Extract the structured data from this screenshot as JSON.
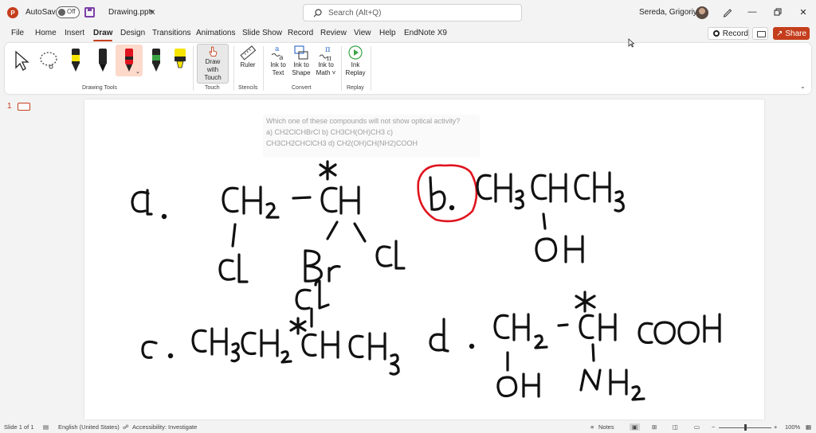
{
  "titlebar": {
    "logo_letter": "P",
    "autosave_label": "AutoSave",
    "autosave_state": "Off",
    "filename": "Drawing.pptx",
    "search_placeholder": "Search (Alt+Q)",
    "username": "Sereda, Grigoriy A"
  },
  "menu": {
    "tabs": [
      "File",
      "Home",
      "Insert",
      "Draw",
      "Design",
      "Transitions",
      "Animations",
      "Slide Show",
      "Record",
      "Review",
      "View",
      "Help",
      "EndNote X9"
    ],
    "active_tab": "Draw",
    "record_label": "Record",
    "share_label": "Share"
  },
  "ribbon": {
    "groups": {
      "drawing_tools": "Drawing Tools",
      "touch": "Touch",
      "stencils": "Stencils",
      "convert": "Convert",
      "replay": "Replay"
    },
    "buttons": {
      "draw_with_touch_1": "Draw with",
      "draw_with_touch_2": "Touch",
      "ruler": "Ruler",
      "ink_to_text_1": "Ink to",
      "ink_to_text_2": "Text",
      "ink_to_shape_1": "Ink to",
      "ink_to_shape_2": "Shape",
      "ink_to_math_1": "Ink to",
      "ink_to_math_2": "Math ˅",
      "ink_replay_1": "Ink",
      "ink_replay_2": "Replay"
    },
    "pen_colors": {
      "yellow_pen": "#f5e400",
      "black_pen": "#111111",
      "red_pen": "#e0141e",
      "green_pen": "#3aa345",
      "highlighter": "#f7e400"
    }
  },
  "slides_panel": {
    "slide_number": "1"
  },
  "slide": {
    "question_line1": "Which one of these compounds will not show optical activity?",
    "question_line2": "a) CH2ClCHBrCl b) CH3CH(OH)CH3 c)",
    "question_line3": "CH3CH2CHClCH3 d) CH2(OH)CH(NH2)COOH"
  },
  "statusbar": {
    "slide_of": "Slide 1 of 1",
    "language": "English (United States)",
    "accessibility": "Accessibility: Investigate",
    "notes": "Notes",
    "zoom": "100%"
  }
}
